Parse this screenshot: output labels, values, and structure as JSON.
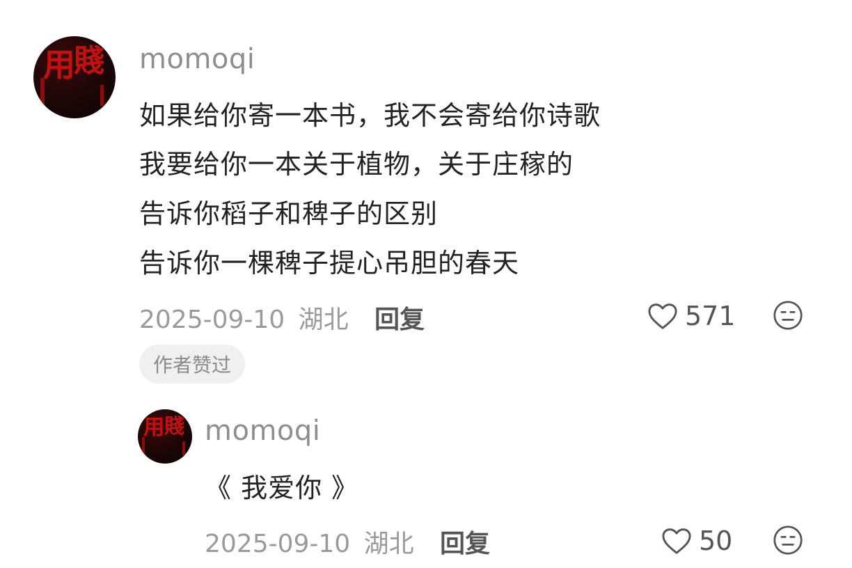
{
  "comment": {
    "username": "momoqi",
    "lines": [
      "如果给你寄一本书，我不会寄给你诗歌",
      "我要给你一本关于植物，关于庄稼的",
      "告诉你稻子和稗子的区别",
      "告诉你一棵稗子提心吊胆的春天"
    ],
    "date": "2025-09-10",
    "location": "湖北",
    "reply_label": "回复",
    "likes": "571",
    "badge": "作者赞过"
  },
  "reply": {
    "username": "momoqi",
    "text": "《 我爱你 》",
    "date": "2025-09-10",
    "location": "湖北",
    "reply_label": "回复",
    "likes": "50"
  },
  "icons": {
    "like": "heart-icon",
    "emoji": "neutral-face-icon"
  },
  "colors": {
    "avatar_red": "#c41010",
    "avatar_dark": "#1a0606",
    "meta_gray": "#9a9a9a"
  }
}
